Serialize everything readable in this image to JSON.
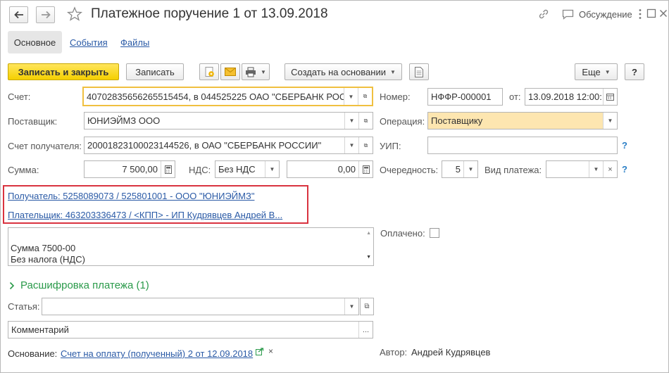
{
  "header": {
    "title": "Платежное поручение 1 от 13.09.2018",
    "back_icon": "arrow-left-icon",
    "forward_icon": "arrow-right-icon",
    "favorite_icon": "star-icon",
    "link_icon": "link-icon",
    "discussion_icon": "chat-icon",
    "discussion_label": "Обсуждение",
    "more_icon": "kebab-icon",
    "maximize_icon": "maximize-icon",
    "close_icon": "close-icon"
  },
  "tabs": [
    {
      "label": "Основное",
      "active": true
    },
    {
      "label": "События",
      "active": false
    },
    {
      "label": "Файлы",
      "active": false
    }
  ],
  "toolbar": {
    "save_close_label": "Записать и закрыть",
    "save_label": "Записать",
    "create_based_label": "Создать на основании",
    "more_label": "Еще",
    "help_label": "?",
    "icons": [
      "attach-file-icon",
      "email-icon",
      "print-icon",
      "report-icon"
    ],
    "accent_color": "#f5d000"
  },
  "fields": {
    "account_label": "Счет:",
    "account_value": "40702835656265515454, в 044525225 ОАО \"СБЕРБАНК РОС",
    "number_label": "Номер:",
    "number_value": "НФФР-000001",
    "from_label": "от:",
    "date_value": "13.09.2018 12:00:",
    "supplier_label": "Поставщик:",
    "supplier_value": "ЮНИЭЙМЗ ООО",
    "operation_label": "Операция:",
    "operation_value": "Поставщику",
    "recipient_account_label": "Счет получателя:",
    "recipient_account_value": "20001823100023144526, в ОАО \"СБЕРБАНК РОССИИ\"",
    "uip_label": "УИП:",
    "uip_value": "",
    "sum_label": "Сумма:",
    "sum_value": "7 500,00",
    "vat_label": "НДС:",
    "vat_value": "Без НДС",
    "vat_sum_value": "0,00",
    "priority_label": "Очередность:",
    "priority_value": "5",
    "payment_type_label": "Вид платежа:",
    "payment_type_value": "",
    "help_mark": "?"
  },
  "links": {
    "recipient": "Получатель: 5258089073 / 525801001 - ООО \"ЮНИЭЙМЗ\"",
    "payer": "Плательщик: 463203336473 / <КПП> - ИП Кудрявцев Андрей В..."
  },
  "purpose": {
    "line1": "Сумма 7500-00",
    "line2": "Без налога (НДС)"
  },
  "paid_label": "Оплачено:",
  "paid_checked": false,
  "decoding": {
    "title": "Расшифровка платежа (1)",
    "color": "#2a9a4a"
  },
  "article_label": "Статья:",
  "article_value": "",
  "comment_placeholder": "Комментарий",
  "basis": {
    "label": "Основание:",
    "link": "Счет на оплату (полученный) 2 от 12.09.2018",
    "remove": "×"
  },
  "author": {
    "label": "Автор:",
    "value": "Андрей Кудрявцев"
  }
}
